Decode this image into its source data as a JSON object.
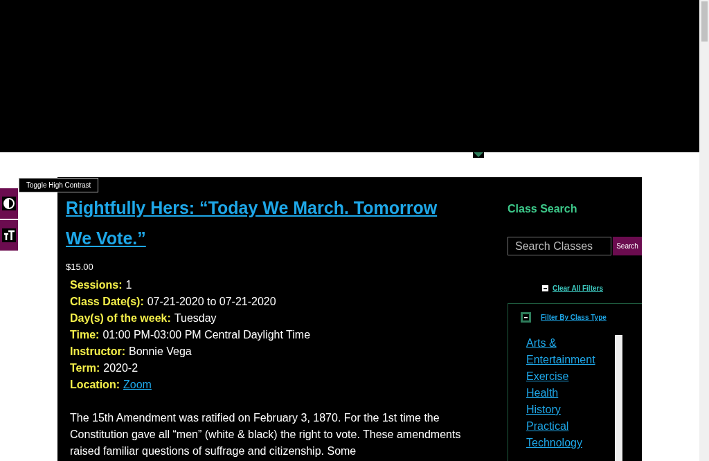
{
  "accessibility_tools": {
    "tooltip": "Toggle High Contrast"
  },
  "course": {
    "title": "Rightfully Hers: “Today We March. Tomorrow We Vote.”",
    "price": "$15.00",
    "details": [
      {
        "label": "Sessions:",
        "value": "1",
        "kind": "text"
      },
      {
        "label": "Class Date(s):",
        "value": "07-21-2020 to 07-21-2020",
        "kind": "text"
      },
      {
        "label": "Day(s) of the week:",
        "value": "Tuesday",
        "kind": "text"
      },
      {
        "label": "Time:",
        "value": "01:00 PM-03:00 PM Central Daylight Time",
        "kind": "text"
      },
      {
        "label": "Instructor:",
        "value": "Bonnie Vega",
        "kind": "text"
      },
      {
        "label": "Term:",
        "value": "2020-2",
        "kind": "text"
      },
      {
        "label": "Location:",
        "value": "Zoom",
        "kind": "link"
      }
    ],
    "description": "The 15th Amendment was ratified on February 3, 1870. For the 1st time the Constitution gave all “men” (white & black) the right to vote. These amendments raised familiar questions of suffrage and citizenship. Some"
  },
  "sidebar": {
    "title": "Class Search",
    "search": {
      "placeholder": "Search Classes",
      "button": "Search"
    },
    "clear_filters": "Clear All Filters",
    "filter": {
      "title": "Filter By Class Type",
      "expanded": true,
      "items": [
        "Arts & Entertainment",
        "Exercise",
        "Health",
        "History",
        "Practical",
        "Technology"
      ]
    }
  }
}
